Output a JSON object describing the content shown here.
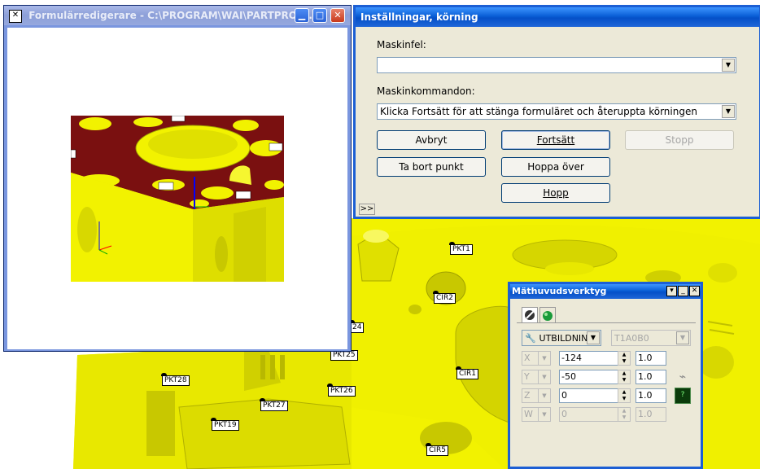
{
  "form_editor": {
    "title": "Formulärredigerare - C:\\PROGRAM\\WAI\\PARTPROG...",
    "preview_labels": [
      "",
      "",
      "",
      "",
      "",
      "",
      ""
    ]
  },
  "settings": {
    "title": "Inställningar, körning",
    "machine_error_label": "Maskinfel:",
    "machine_error_value": "",
    "machine_commands_label": "Maskinkommandon:",
    "machine_commands_value": "Klicka Fortsätt för att stänga formuläret och återuppta körningen",
    "buttons": {
      "cancel": "Avbryt",
      "continue": "Fortsätt",
      "stop": "Stopp",
      "delete_point": "Ta bort punkt",
      "skip": "Hoppa över",
      "jump": "Hopp"
    },
    "expand": ">>"
  },
  "probe_tool": {
    "title": "Mäthuvudsverktyg",
    "mode_select": "UTBILDNIN",
    "tip_select": "T1A0B0",
    "rows": [
      {
        "axis": "X",
        "value": "-124",
        "step": "1.0",
        "enabled": true
      },
      {
        "axis": "Y",
        "value": "-50",
        "step": "1.0",
        "enabled": true
      },
      {
        "axis": "Z",
        "value": "0",
        "step": "1.0",
        "enabled": true
      },
      {
        "axis": "W",
        "value": "0",
        "step": "1.0",
        "enabled": false
      }
    ]
  },
  "cad_labels": [
    {
      "id": "PKT1",
      "text": "PKT1"
    },
    {
      "id": "CIR2",
      "text": "CIR2"
    },
    {
      "id": "PKT24",
      "text": "24"
    },
    {
      "id": "PKT25",
      "text": "PKT25"
    },
    {
      "id": "CIR1",
      "text": "CIR1"
    },
    {
      "id": "PKT26",
      "text": "PKT26"
    },
    {
      "id": "PKT28",
      "text": "PKT28"
    },
    {
      "id": "PKT27",
      "text": "PKT27"
    },
    {
      "id": "PKT19",
      "text": "PKT19"
    },
    {
      "id": "CIR5",
      "text": "CIR5"
    }
  ],
  "colors": {
    "part_yellow": "#f2f200",
    "part_shadow": "#b8b800",
    "part_red": "#7a1010",
    "title_blue": "#0a5fd6"
  }
}
